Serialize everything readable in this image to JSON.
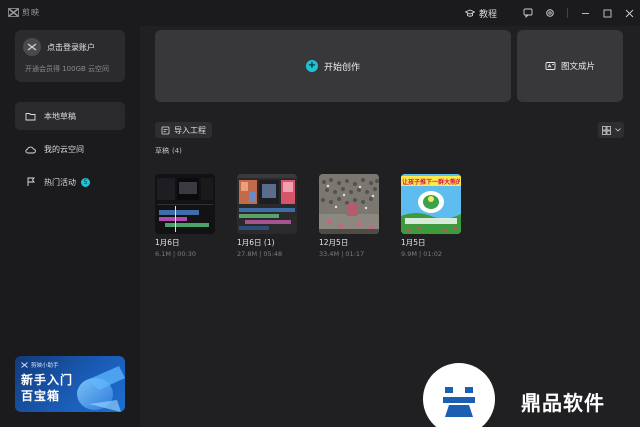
{
  "app": {
    "name": "剪映"
  },
  "topbar": {
    "tutorial_label": "教程"
  },
  "sidebar": {
    "login": {
      "label": "点击登录账户",
      "subtitle": "开通会员得 100GB 云空间"
    },
    "items": [
      {
        "label": "本地草稿",
        "icon": "folder-icon",
        "active": true
      },
      {
        "label": "我的云空间",
        "icon": "cloud-icon",
        "active": false
      },
      {
        "label": "热门活动",
        "icon": "flag-icon",
        "active": false,
        "badge": "5"
      }
    ],
    "promo": {
      "brand": "剪映小助手",
      "line1": "新手入门",
      "line2": "百宝箱"
    }
  },
  "main": {
    "create_label": "开始创作",
    "img2video_label": "图文成片",
    "import_label": "导入工程",
    "section": {
      "title": "草稿",
      "count": "(4)"
    },
    "drafts": [
      {
        "name": "1月6日",
        "size": "6.1M",
        "duration": "00:30"
      },
      {
        "name": "1月6日 (1)",
        "size": "27.8M",
        "duration": "05:48"
      },
      {
        "name": "12月5日",
        "size": "33.4M",
        "duration": "01:17"
      },
      {
        "name": "1月5日",
        "size": "9.9M",
        "duration": "01:02"
      }
    ],
    "thumb4_caption": "让孩子推下一群大熊的"
  },
  "watermark": {
    "text": "鼎品软件"
  },
  "colors": {
    "accent": "#1fc3d4",
    "background": "#1b1b1d",
    "card": "#38383b"
  }
}
